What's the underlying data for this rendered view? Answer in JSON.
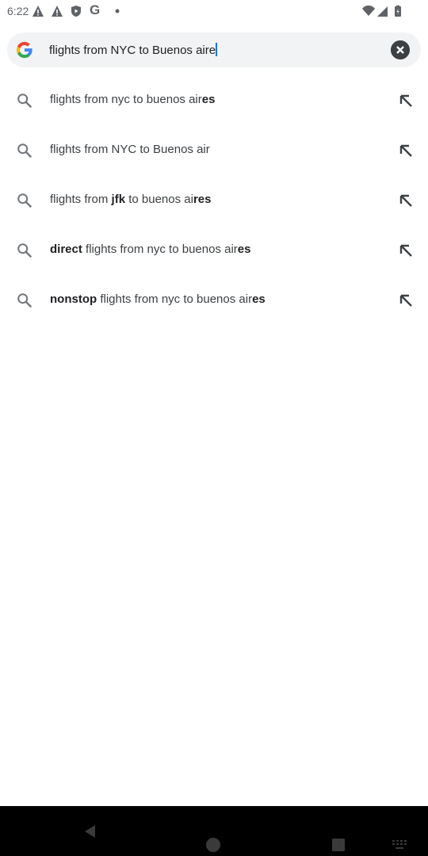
{
  "status_bar": {
    "time": "6:22",
    "icons": [
      "alert-icon",
      "alert-icon",
      "shield-play-icon",
      "google-g-icon",
      "dot-icon",
      "wifi-icon",
      "signal-icon",
      "battery-icon"
    ]
  },
  "search": {
    "query": "flights from NYC to Buenos aire",
    "clear_icon": "close-icon"
  },
  "suggestions": [
    {
      "parts": [
        {
          "t": "flights from nyc to buenos air",
          "b": false
        },
        {
          "t": "es",
          "b": true
        }
      ]
    },
    {
      "parts": [
        {
          "t": "flights from NYC to Buenos air",
          "b": false
        }
      ]
    },
    {
      "parts": [
        {
          "t": "flights from ",
          "b": false
        },
        {
          "t": "jfk",
          "b": true
        },
        {
          "t": " to buenos ai",
          "b": false
        },
        {
          "t": "res",
          "b": true
        }
      ]
    },
    {
      "parts": [
        {
          "t": "direct",
          "b": true
        },
        {
          "t": " flights from nyc to buenos air",
          "b": false
        },
        {
          "t": "es",
          "b": true
        }
      ]
    },
    {
      "parts": [
        {
          "t": "nonstop",
          "b": true
        },
        {
          "t": " flights from nyc to buenos air",
          "b": false
        },
        {
          "t": "es",
          "b": true
        }
      ]
    }
  ],
  "nav_bar": {
    "icons": [
      "back-icon",
      "home-icon",
      "recents-icon",
      "keyboard-icon"
    ]
  }
}
